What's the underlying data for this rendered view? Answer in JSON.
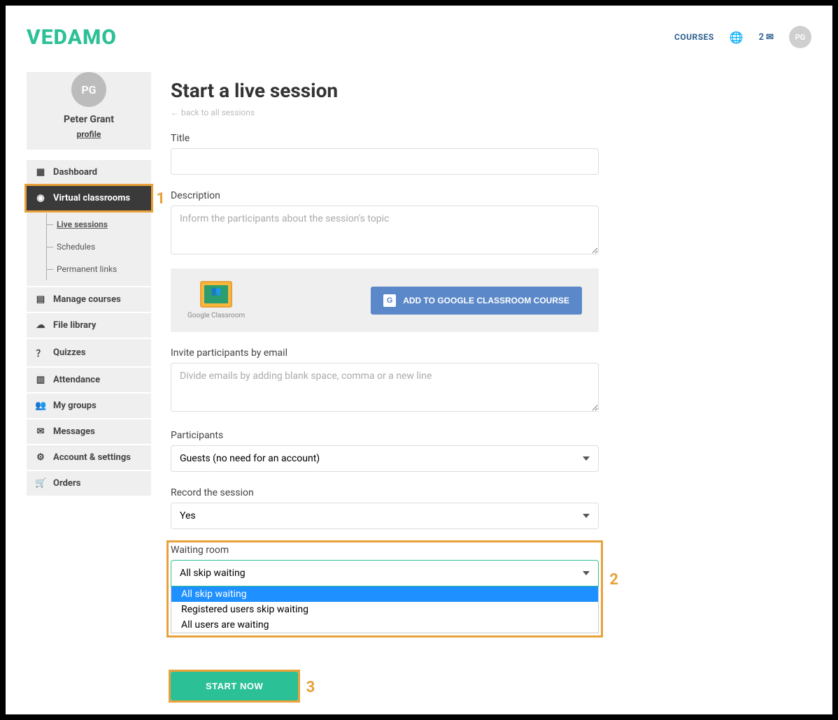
{
  "brand": "VEDAMO",
  "topbar": {
    "courses": "COURSES",
    "notif_count": "2",
    "avatar_initials": "PG"
  },
  "profile": {
    "avatar_initials": "PG",
    "name": "Peter Grant",
    "profile_link": "profile"
  },
  "sidebar": {
    "dashboard": "Dashboard",
    "virtual_classrooms": "Virtual classrooms",
    "sub": {
      "live_sessions": "Live sessions",
      "schedules": "Schedules",
      "permanent_links": "Permanent links"
    },
    "manage_courses": "Manage courses",
    "file_library": "File library",
    "quizzes": "Quizzes",
    "attendance": "Attendance",
    "my_groups": "My groups",
    "messages": "Messages",
    "account_settings": "Account & settings",
    "orders": "Orders"
  },
  "page": {
    "title": "Start a live session",
    "back_link": "back to all sessions"
  },
  "form": {
    "title_label": "Title",
    "description_label": "Description",
    "description_placeholder": "Inform the participants about the session's topic",
    "gc_caption": "Google Classroom",
    "gc_button": "ADD TO GOOGLE CLASSROOM COURSE",
    "invite_label": "Invite participants by email",
    "invite_placeholder": "Divide emails by adding blank space, comma or a new line",
    "participants_label": "Participants",
    "participants_value": "Guests (no need for an account)",
    "record_label": "Record the session",
    "record_value": "Yes",
    "waiting_label": "Waiting room",
    "waiting_value": "All skip waiting",
    "waiting_options": {
      "o1": "All skip waiting",
      "o2": "Registered users skip waiting",
      "o3": "All users are waiting"
    },
    "start_button": "START NOW"
  },
  "annotations": {
    "n1": "1",
    "n2": "2",
    "n3": "3"
  }
}
